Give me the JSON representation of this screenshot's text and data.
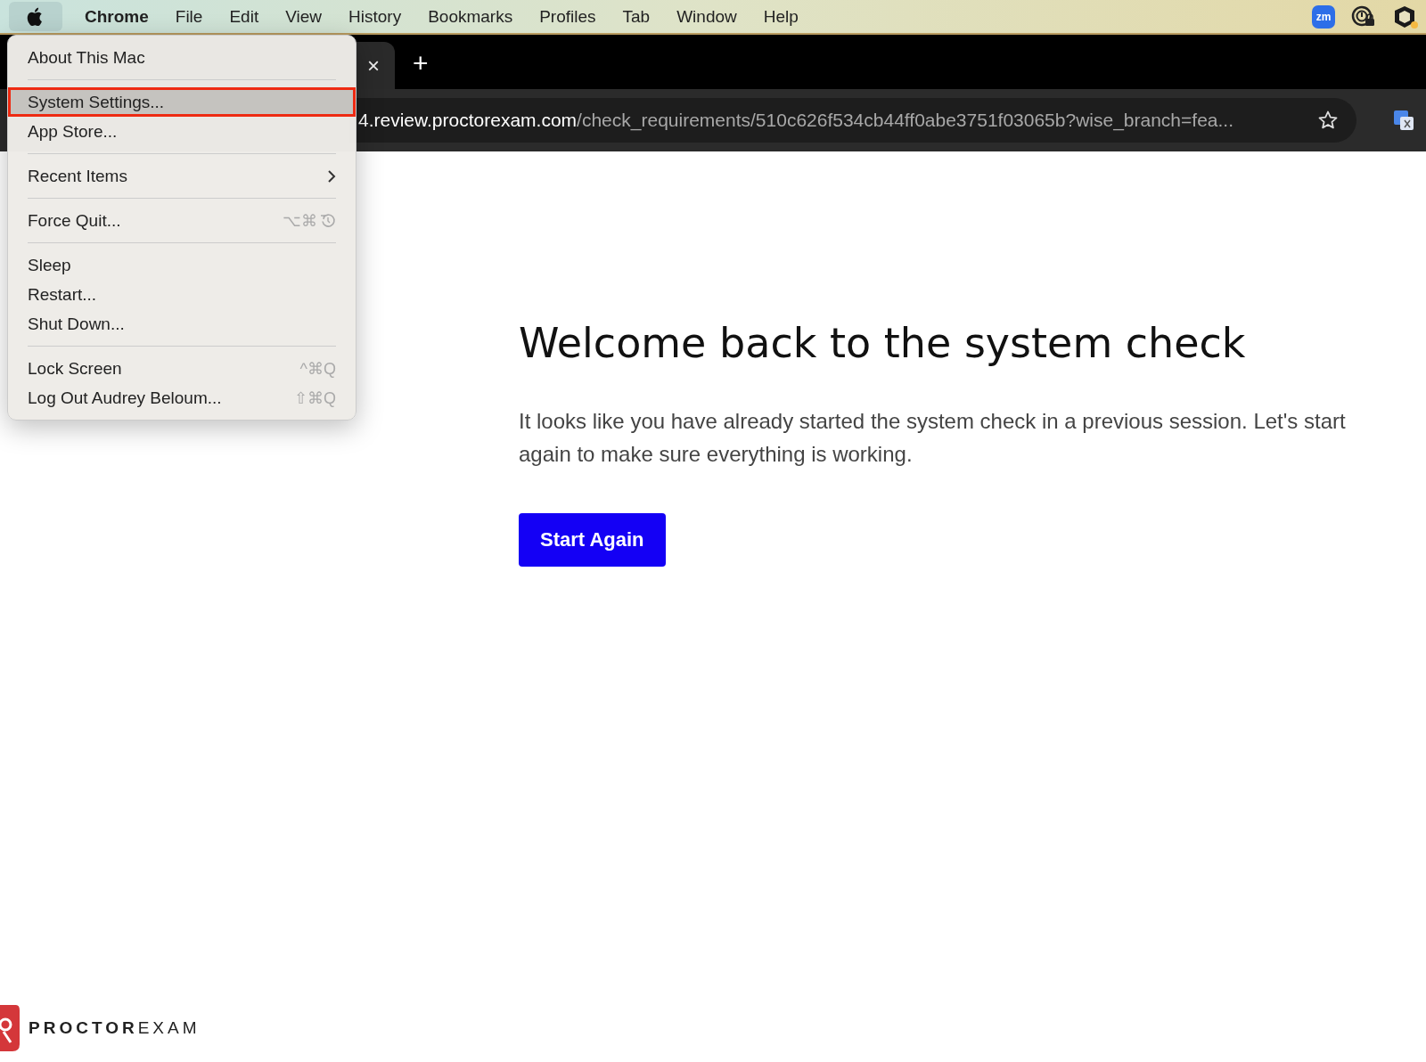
{
  "menu_bar": {
    "items": [
      {
        "label": "Chrome",
        "kind": "app"
      },
      {
        "label": "File",
        "kind": "menu"
      },
      {
        "label": "Edit",
        "kind": "menu"
      },
      {
        "label": "View",
        "kind": "menu"
      },
      {
        "label": "History",
        "kind": "menu"
      },
      {
        "label": "Bookmarks",
        "kind": "menu"
      },
      {
        "label": "Profiles",
        "kind": "menu"
      },
      {
        "label": "Tab",
        "kind": "menu"
      },
      {
        "label": "Window",
        "kind": "menu"
      },
      {
        "label": "Help",
        "kind": "menu"
      }
    ],
    "status_icons": [
      {
        "label": "zm"
      }
    ]
  },
  "tab_strip": {
    "close": "×",
    "new_tab": "+"
  },
  "address_bar": {
    "host": "4.review.proctorexam.com",
    "path": "/check_requirements/510c626f534cb44ff0abe3751f03065b?wise_branch=fea..."
  },
  "apple_menu": {
    "items": [
      {
        "kind": "item",
        "label": "About This Mac",
        "highlighted": false
      },
      {
        "kind": "separator"
      },
      {
        "kind": "item",
        "label": "System Settings...",
        "highlighted": true
      },
      {
        "kind": "item",
        "label": "App Store...",
        "highlighted": false
      },
      {
        "kind": "separator"
      },
      {
        "kind": "submenu",
        "label": "Recent Items",
        "highlighted": false
      },
      {
        "kind": "separator"
      },
      {
        "kind": "item",
        "label": "Force Quit...",
        "shortcut": "⌥⌘",
        "shortcut_icon": true,
        "highlighted": false
      },
      {
        "kind": "separator"
      },
      {
        "kind": "item",
        "label": "Sleep",
        "highlighted": false
      },
      {
        "kind": "item",
        "label": "Restart...",
        "highlighted": false
      },
      {
        "kind": "item",
        "label": "Shut Down...",
        "highlighted": false
      },
      {
        "kind": "separator"
      },
      {
        "kind": "item",
        "label": "Lock Screen",
        "shortcut": "^⌘Q",
        "highlighted": false
      },
      {
        "kind": "item",
        "label": "Log Out Audrey Beloum...",
        "shortcut": "⇧⌘Q",
        "highlighted": false
      }
    ]
  },
  "page": {
    "heading": "Welcome back to the system check",
    "text": "It looks like you have already started the system check in a previous session. Let's start again to make sure everything is working.",
    "button": "Start Again"
  },
  "footer": {
    "logo_bold": "PROCTOR",
    "logo_light": "EXAM"
  }
}
